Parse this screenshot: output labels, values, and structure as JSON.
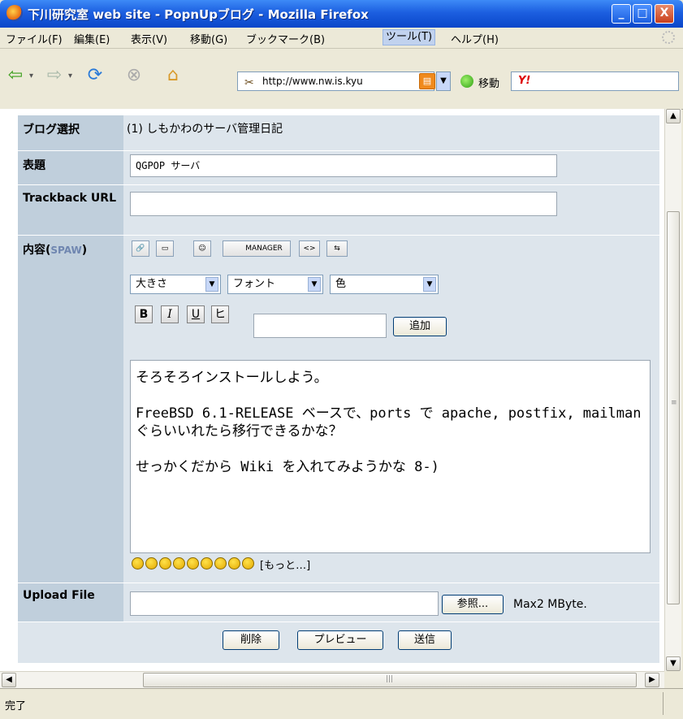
{
  "window": {
    "title": "下川研究室 web site - PopnUpブログ - Mozilla Firefox",
    "minimize": "_",
    "maximize": "□",
    "close": "X"
  },
  "menubar": {
    "items": [
      "ファイル(F)",
      "編集(E)",
      "表示(V)",
      "移動(G)",
      "ブックマーク(B)",
      "ツール(T)",
      "ヘルプ(H)"
    ]
  },
  "navbar": {
    "url": "http://www.nw.is.kyu",
    "go_label": "移動",
    "search_logo": "Y!",
    "rss_label": "▤"
  },
  "form": {
    "blog_label": "ブログ選択",
    "blog_value": "(1) しもかわのサーバ管理日記",
    "title_label": "表題",
    "title_value": "QGPOP サーバ",
    "trackback_label": "Trackback URL",
    "trackback_value": "",
    "content_label": "内容(",
    "content_label_spaw": "SPAW",
    "content_label_end": ")",
    "toolbar_manager": "MANAGER",
    "size_select": "大きさ",
    "font_select": "フォント",
    "color_select": "色",
    "bold": "B",
    "italic": "I",
    "underline": "U",
    "strike": "ヒ",
    "add_button": "追加",
    "add_input_value": "",
    "body_text": "そろそろインストールしよう。\n\nFreeBSD 6.1-RELEASE ベースで、ports で apache, postfix, mailman ぐらいいれたら移行できるかな？\n\nせっかくだから Wiki を入れてみようかな 8-)",
    "more_emoji": "[もっと…]",
    "upload_label": "Upload File",
    "upload_value": "",
    "browse_button": "参照...",
    "max_size": "Max2 MByte.",
    "delete_button": "削除",
    "preview_button": "プレビュー",
    "send_button": "送信"
  },
  "statusbar": {
    "text": "完了"
  }
}
